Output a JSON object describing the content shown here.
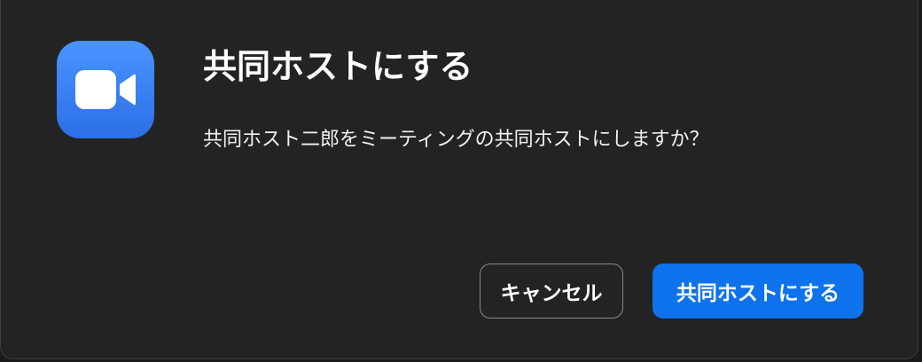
{
  "dialog": {
    "app_icon": "video-camera-icon",
    "title": "共同ホストにする",
    "message": "共同ホスト二郎をミーティングの共同ホストにしますか？",
    "buttons": {
      "cancel_label": "キャンセル",
      "confirm_label": "共同ホストにする"
    }
  },
  "colors": {
    "dialog_background": "#232323",
    "primary_button": "#0e72ed",
    "app_icon_blue": "#2c6fe6",
    "text": "#ffffff"
  }
}
